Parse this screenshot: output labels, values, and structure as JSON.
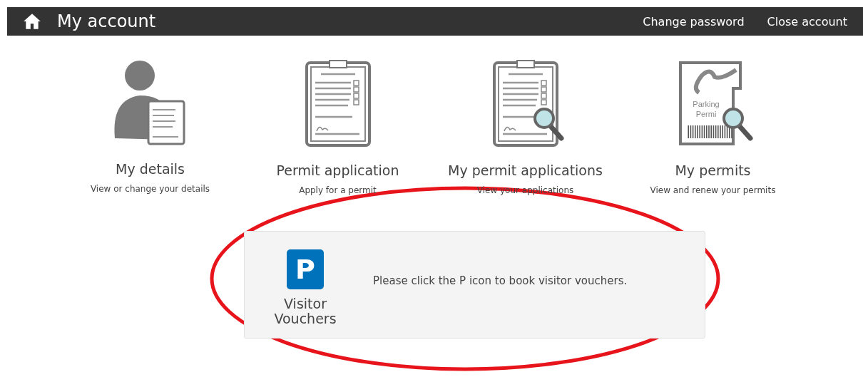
{
  "header": {
    "title": "My account",
    "links": [
      "Change password",
      "Close account"
    ]
  },
  "tiles": [
    {
      "kind": "person",
      "title": "My details",
      "subtitle": "View or change your details"
    },
    {
      "kind": "clipboard",
      "title": "Permit application",
      "subtitle": "Apply for a permit"
    },
    {
      "kind": "clipboard-search",
      "title": "My permit applications",
      "subtitle": "View your applications"
    },
    {
      "kind": "ticket-search",
      "title": "My permits",
      "subtitle": "View and renew your permits",
      "ticket_text": [
        "Parking",
        "Permi"
      ]
    }
  ],
  "vouchers": {
    "icon_letter": "P",
    "label": "Visitor Vouchers",
    "message": "Please click the P icon to book visitor vouchers."
  }
}
